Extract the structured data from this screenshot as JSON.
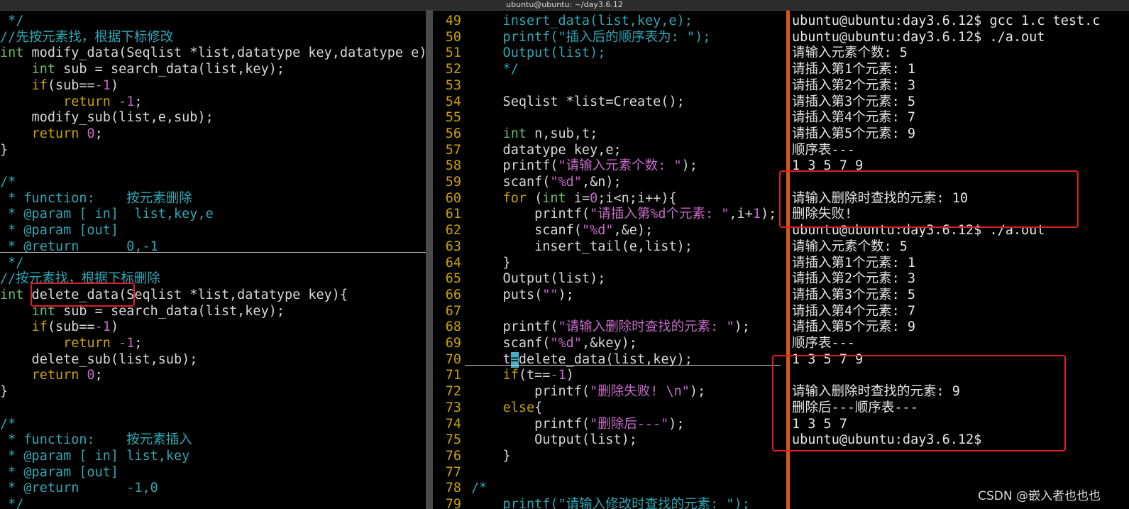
{
  "window": {
    "title": "ubuntu@ubuntu: ~/day3.6.12"
  },
  "left_pane": [
    {
      "segs": [
        {
          "t": " */",
          "c": "comment"
        }
      ]
    },
    {
      "segs": [
        {
          "t": "//先按元素找，根据下标修改",
          "c": "comment"
        }
      ]
    },
    {
      "segs": [
        {
          "t": "int",
          "c": "type"
        },
        {
          "t": " modify_data(Seqlist *list,datatype key,datatype e){",
          "c": "plain"
        }
      ]
    },
    {
      "segs": [
        {
          "t": "    ",
          "c": "plain"
        },
        {
          "t": "int",
          "c": "type"
        },
        {
          "t": " sub = search_data(list,key);",
          "c": "plain"
        }
      ]
    },
    {
      "segs": [
        {
          "t": "    ",
          "c": "plain"
        },
        {
          "t": "if",
          "c": "kw"
        },
        {
          "t": "(sub==",
          "c": "plain"
        },
        {
          "t": "-1",
          "c": "num"
        },
        {
          "t": ")",
          "c": "plain"
        }
      ]
    },
    {
      "segs": [
        {
          "t": "        ",
          "c": "plain"
        },
        {
          "t": "return",
          "c": "kw"
        },
        {
          "t": " ",
          "c": "plain"
        },
        {
          "t": "-1",
          "c": "num"
        },
        {
          "t": ";",
          "c": "plain"
        }
      ]
    },
    {
      "segs": [
        {
          "t": "    modify_sub(list,e,sub);",
          "c": "plain"
        }
      ]
    },
    {
      "segs": [
        {
          "t": "    ",
          "c": "plain"
        },
        {
          "t": "return",
          "c": "kw"
        },
        {
          "t": " ",
          "c": "plain"
        },
        {
          "t": "0",
          "c": "num"
        },
        {
          "t": ";",
          "c": "plain"
        }
      ]
    },
    {
      "segs": [
        {
          "t": "}",
          "c": "plain"
        }
      ]
    },
    {
      "segs": []
    },
    {
      "segs": [
        {
          "t": "/*",
          "c": "comment"
        }
      ]
    },
    {
      "segs": [
        {
          "t": " * function:    按元素删除",
          "c": "comment"
        }
      ]
    },
    {
      "segs": [
        {
          "t": " * @param [ in]  list,key,e",
          "c": "comment"
        }
      ]
    },
    {
      "segs": [
        {
          "t": " * @param [out]",
          "c": "comment"
        }
      ]
    },
    {
      "segs": [
        {
          "t": " * @return      0,-1",
          "c": "comment"
        }
      ]
    },
    {
      "segs": [
        {
          "t": " */",
          "c": "comment"
        }
      ]
    },
    {
      "segs": [
        {
          "t": "//按元素找，根据下标删除",
          "c": "comment"
        }
      ]
    },
    {
      "segs": [
        {
          "t": "int",
          "c": "type"
        },
        {
          "t": " delete_data(Seqlist *list,datatype key){",
          "c": "plain"
        }
      ]
    },
    {
      "segs": [
        {
          "t": "    ",
          "c": "plain"
        },
        {
          "t": "int",
          "c": "type"
        },
        {
          "t": " sub = search_data(list,key);",
          "c": "plain"
        }
      ]
    },
    {
      "segs": [
        {
          "t": "    ",
          "c": "plain"
        },
        {
          "t": "if",
          "c": "kw"
        },
        {
          "t": "(sub==",
          "c": "plain"
        },
        {
          "t": "-1",
          "c": "num"
        },
        {
          "t": ")",
          "c": "plain"
        }
      ]
    },
    {
      "segs": [
        {
          "t": "        ",
          "c": "plain"
        },
        {
          "t": "return",
          "c": "kw"
        },
        {
          "t": " ",
          "c": "plain"
        },
        {
          "t": "-1",
          "c": "num"
        },
        {
          "t": ";",
          "c": "plain"
        }
      ]
    },
    {
      "segs": [
        {
          "t": "    delete_sub(list,sub);",
          "c": "plain"
        }
      ]
    },
    {
      "segs": [
        {
          "t": "    ",
          "c": "plain"
        },
        {
          "t": "return",
          "c": "kw"
        },
        {
          "t": " ",
          "c": "plain"
        },
        {
          "t": "0",
          "c": "num"
        },
        {
          "t": ";",
          "c": "plain"
        }
      ]
    },
    {
      "segs": [
        {
          "t": "}",
          "c": "plain"
        }
      ]
    },
    {
      "segs": []
    },
    {
      "segs": [
        {
          "t": "/*",
          "c": "comment"
        }
      ]
    },
    {
      "segs": [
        {
          "t": " * function:    按元素插入",
          "c": "comment"
        }
      ]
    },
    {
      "segs": [
        {
          "t": " * @param [ in] list,key",
          "c": "comment"
        }
      ]
    },
    {
      "segs": [
        {
          "t": " * @param [out]",
          "c": "comment"
        }
      ]
    },
    {
      "segs": [
        {
          "t": " * @return      -1,0",
          "c": "comment"
        }
      ]
    },
    {
      "segs": [
        {
          "t": " */",
          "c": "comment"
        }
      ]
    }
  ],
  "middle_pane": [
    {
      "n": "49",
      "segs": [
        {
          "t": "    insert_data(list,key,e);",
          "c": "comment"
        }
      ]
    },
    {
      "n": "50",
      "segs": [
        {
          "t": "    printf(\"插入后的顺序表为: \");",
          "c": "comment"
        }
      ]
    },
    {
      "n": "51",
      "segs": [
        {
          "t": "    Output(list);",
          "c": "comment"
        }
      ]
    },
    {
      "n": "52",
      "segs": [
        {
          "t": "    */",
          "c": "comment"
        }
      ]
    },
    {
      "n": "53",
      "segs": []
    },
    {
      "n": "54",
      "segs": [
        {
          "t": "    Seqlist *list=Create();",
          "c": "plain"
        }
      ]
    },
    {
      "n": "55",
      "segs": []
    },
    {
      "n": "56",
      "segs": [
        {
          "t": "    ",
          "c": "plain"
        },
        {
          "t": "int",
          "c": "type"
        },
        {
          "t": " n,sub,t;",
          "c": "plain"
        }
      ]
    },
    {
      "n": "57",
      "segs": [
        {
          "t": "    datatype key,e;",
          "c": "plain"
        }
      ]
    },
    {
      "n": "58",
      "segs": [
        {
          "t": "    printf(",
          "c": "plain"
        },
        {
          "t": "\"请输入元素个数: \"",
          "c": "str"
        },
        {
          "t": ");",
          "c": "plain"
        }
      ]
    },
    {
      "n": "59",
      "segs": [
        {
          "t": "    scanf(",
          "c": "plain"
        },
        {
          "t": "\"%d\"",
          "c": "str"
        },
        {
          "t": ",&n);",
          "c": "plain"
        }
      ]
    },
    {
      "n": "60",
      "segs": [
        {
          "t": "    ",
          "c": "plain"
        },
        {
          "t": "for",
          "c": "kw"
        },
        {
          "t": " (",
          "c": "plain"
        },
        {
          "t": "int",
          "c": "type"
        },
        {
          "t": " i=",
          "c": "plain"
        },
        {
          "t": "0",
          "c": "num"
        },
        {
          "t": ";i<n;i++){",
          "c": "plain"
        }
      ]
    },
    {
      "n": "61",
      "segs": [
        {
          "t": "        printf(",
          "c": "plain"
        },
        {
          "t": "\"请插入第%d个元素: \"",
          "c": "str"
        },
        {
          "t": ",i+",
          "c": "plain"
        },
        {
          "t": "1",
          "c": "num"
        },
        {
          "t": ");",
          "c": "plain"
        }
      ]
    },
    {
      "n": "62",
      "segs": [
        {
          "t": "        scanf(",
          "c": "plain"
        },
        {
          "t": "\"%d\"",
          "c": "str"
        },
        {
          "t": ",&e);",
          "c": "plain"
        }
      ]
    },
    {
      "n": "63",
      "segs": [
        {
          "t": "        insert_tail(e,list);",
          "c": "plain"
        }
      ]
    },
    {
      "n": "64",
      "segs": [
        {
          "t": "    }",
          "c": "plain"
        }
      ]
    },
    {
      "n": "65",
      "segs": [
        {
          "t": "    Output(list);",
          "c": "plain"
        }
      ]
    },
    {
      "n": "66",
      "segs": [
        {
          "t": "    puts(",
          "c": "plain"
        },
        {
          "t": "\"\"",
          "c": "str"
        },
        {
          "t": ");",
          "c": "plain"
        }
      ]
    },
    {
      "n": "67",
      "segs": []
    },
    {
      "n": "68",
      "segs": [
        {
          "t": "    printf(",
          "c": "plain"
        },
        {
          "t": "\"请输入删除时查找的元素: \"",
          "c": "str"
        },
        {
          "t": ");",
          "c": "plain"
        }
      ]
    },
    {
      "n": "69",
      "segs": [
        {
          "t": "    scanf(",
          "c": "plain"
        },
        {
          "t": "\"%d\"",
          "c": "str"
        },
        {
          "t": ",&key);",
          "c": "plain"
        }
      ]
    },
    {
      "n": "70",
      "segs": [
        {
          "t": "    t",
          "c": "plain"
        },
        {
          "t": "=",
          "c": "cursor"
        },
        {
          "t": "delete_data(list,key);",
          "c": "plain"
        }
      ]
    },
    {
      "n": "71",
      "segs": [
        {
          "t": "    ",
          "c": "plain"
        },
        {
          "t": "if",
          "c": "kw"
        },
        {
          "t": "(t==",
          "c": "plain"
        },
        {
          "t": "-1",
          "c": "num"
        },
        {
          "t": ")",
          "c": "plain"
        }
      ]
    },
    {
      "n": "72",
      "segs": [
        {
          "t": "        printf(",
          "c": "plain"
        },
        {
          "t": "\"删除失败! \\n\"",
          "c": "str"
        },
        {
          "t": ");",
          "c": "plain"
        }
      ]
    },
    {
      "n": "73",
      "segs": [
        {
          "t": "    ",
          "c": "plain"
        },
        {
          "t": "else",
          "c": "kw"
        },
        {
          "t": "{",
          "c": "plain"
        }
      ]
    },
    {
      "n": "74",
      "segs": [
        {
          "t": "        printf(",
          "c": "plain"
        },
        {
          "t": "\"删除后---\"",
          "c": "str"
        },
        {
          "t": ");",
          "c": "plain"
        }
      ]
    },
    {
      "n": "75",
      "segs": [
        {
          "t": "        Output(list);",
          "c": "plain"
        }
      ]
    },
    {
      "n": "76",
      "segs": [
        {
          "t": "    }",
          "c": "plain"
        }
      ]
    },
    {
      "n": "77",
      "segs": []
    },
    {
      "n": "78",
      "segs": [
        {
          "t": "/*",
          "c": "comment"
        }
      ]
    },
    {
      "n": "79",
      "segs": [
        {
          "t": "    printf(\"请输入修改时查找的元素: \");",
          "c": "comment"
        }
      ]
    }
  ],
  "terminal": [
    "ubuntu@ubuntu:day3.6.12$ gcc 1.c test.c",
    "ubuntu@ubuntu:day3.6.12$ ./a.out",
    "请输入元素个数: 5",
    "请插入第1个元素: 1",
    "请插入第2个元素: 3",
    "请插入第3个元素: 5",
    "请插入第4个元素: 7",
    "请插入第5个元素: 9",
    "顺序表---",
    "1 3 5 7 9",
    "",
    "请输入删除时查找的元素: 10",
    "删除失败!",
    "ubuntu@ubuntu:day3.6.12$ ./a.out",
    "请输入元素个数: 5",
    "请插入第1个元素: 1",
    "请插入第2个元素: 3",
    "请插入第3个元素: 5",
    "请插入第4个元素: 7",
    "请插入第5个元素: 9",
    "顺序表---",
    "1 3 5 7 9",
    "",
    "请输入删除时查找的元素: 9",
    "删除后---顺序表---",
    "1 3 5 7",
    "ubuntu@ubuntu:day3.6.12$"
  ],
  "watermark": "CSDN @嵌入者也也也",
  "colors": {
    "comment": "#2ea7b5",
    "keyword": "#c9a100",
    "type": "#6bb86b",
    "string": "#c66bc7",
    "annotation_box": "#e02020"
  }
}
